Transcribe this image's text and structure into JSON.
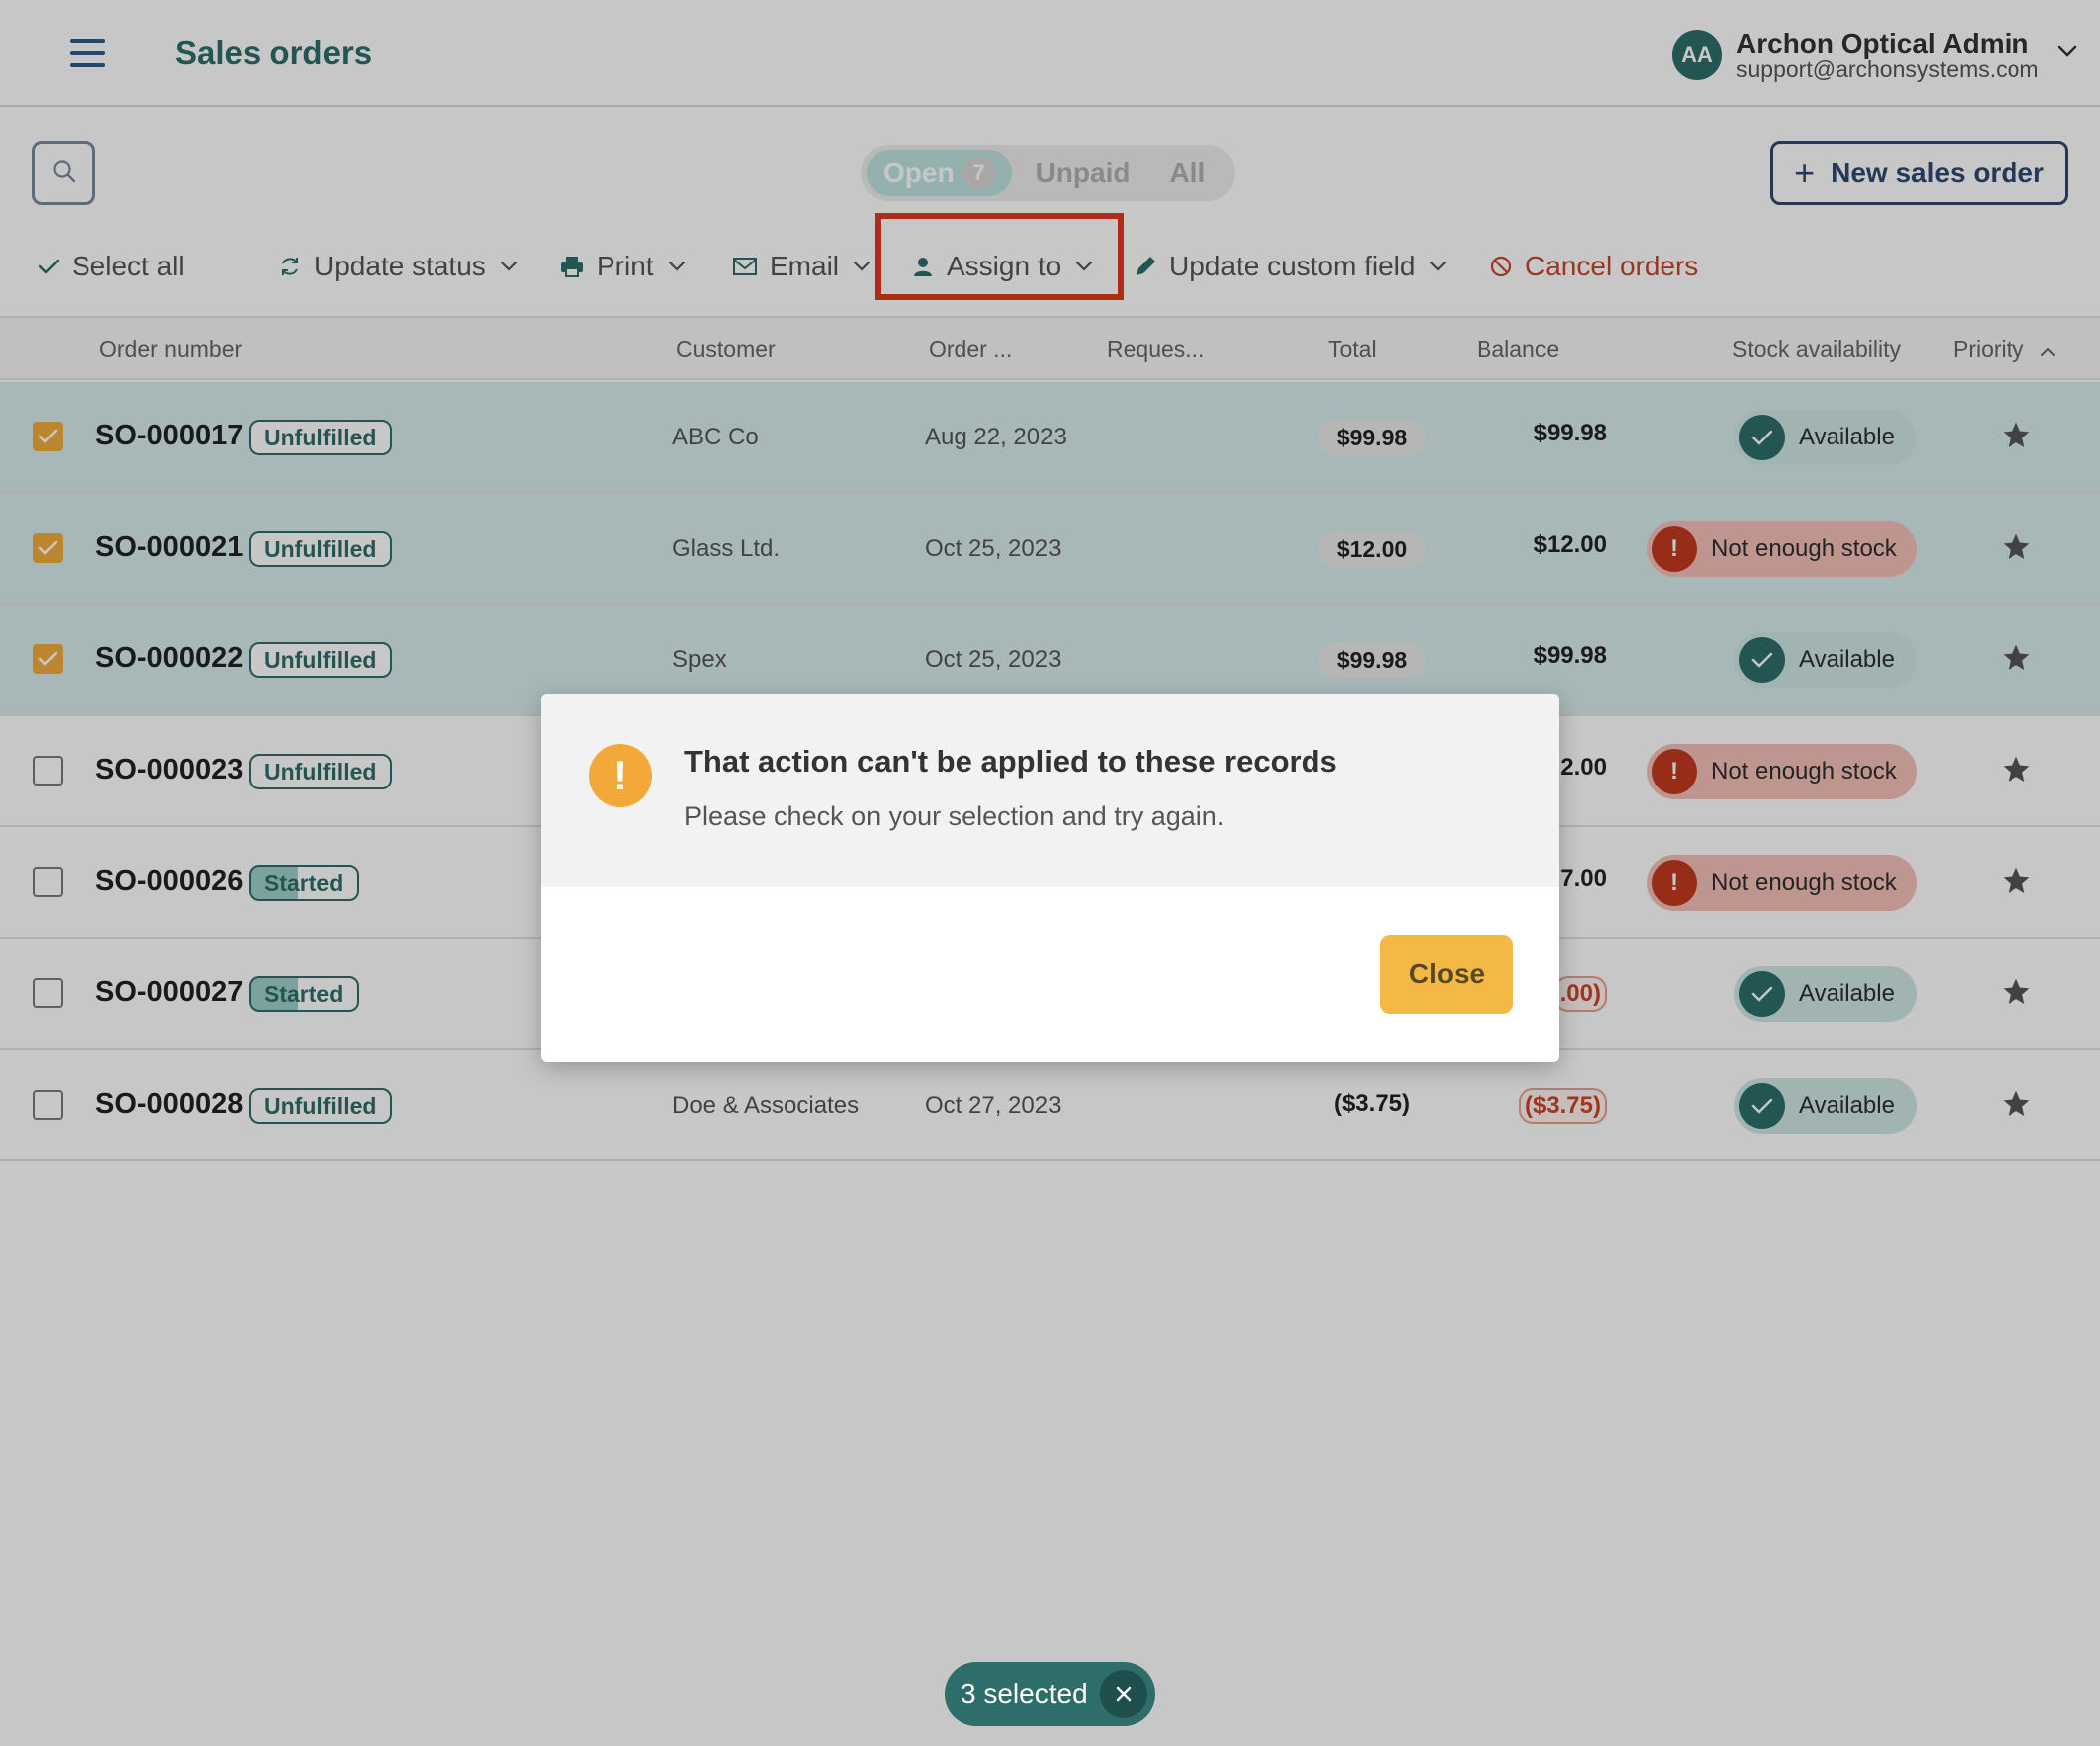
{
  "header": {
    "title": "Sales orders",
    "menu_icon": "hamburger-menu-icon",
    "user": {
      "initials": "AA",
      "name": "Archon Optical Admin",
      "email": "support@archonsystems.com"
    }
  },
  "tabs": [
    {
      "label": "Open",
      "count": "7",
      "active": true
    },
    {
      "label": "Unpaid"
    },
    {
      "label": "All"
    }
  ],
  "new_order_label": "New sales order",
  "actions": {
    "select_all": "Select all",
    "update_status": "Update status",
    "print": "Print",
    "email": "Email",
    "assign_to": "Assign to",
    "update_custom_field": "Update custom field",
    "cancel_orders": "Cancel orders"
  },
  "table": {
    "columns": [
      "Order number",
      "Customer",
      "Order ...",
      "Reques...",
      "Total",
      "Balance",
      "Stock availability",
      "Priority"
    ],
    "rows": [
      {
        "order": "SO-000017",
        "status": "Unfulfilled",
        "customer": "ABC Co",
        "date": "Aug 22, 2023",
        "total": "$99.98",
        "balance": "$99.98",
        "stock": "Available",
        "checked": true
      },
      {
        "order": "SO-000021",
        "status": "Unfulfilled",
        "customer": "Glass Ltd.",
        "date": "Oct 25, 2023",
        "total": "$12.00",
        "balance": "$12.00",
        "stock": "Not enough stock",
        "checked": true
      },
      {
        "order": "SO-000022",
        "status": "Unfulfilled",
        "customer": "Spex",
        "date": "Oct 25, 2023",
        "total": "$99.98",
        "balance": "$99.98",
        "stock": "Available",
        "checked": true
      },
      {
        "order": "SO-000023",
        "status": "Unfulfilled",
        "balance": "2.00",
        "stock": "Not enough stock",
        "checked": false
      },
      {
        "order": "SO-000026",
        "status": "Started",
        "balance": "7.00",
        "stock": "Not enough stock",
        "checked": false
      },
      {
        "order": "SO-000027",
        "status": "Started",
        "balance": ".00)",
        "stock": "Available",
        "checked": false
      },
      {
        "order": "SO-000028",
        "status": "Unfulfilled",
        "customer": "Doe & Associates",
        "date": "Oct 27, 2023",
        "total": "($3.75)",
        "balance": "($3.75)",
        "stock": "Available",
        "checked": false
      }
    ]
  },
  "dialog": {
    "title": "That action can't be applied to these records",
    "message": "Please check on your selection and try again.",
    "close_label": "Close"
  },
  "selection": {
    "label": "3 selected"
  },
  "colors": {
    "accent": "#2e6e6a",
    "warning": "#f3a939",
    "danger": "#c8452c",
    "highlight": "#e03a1e"
  }
}
